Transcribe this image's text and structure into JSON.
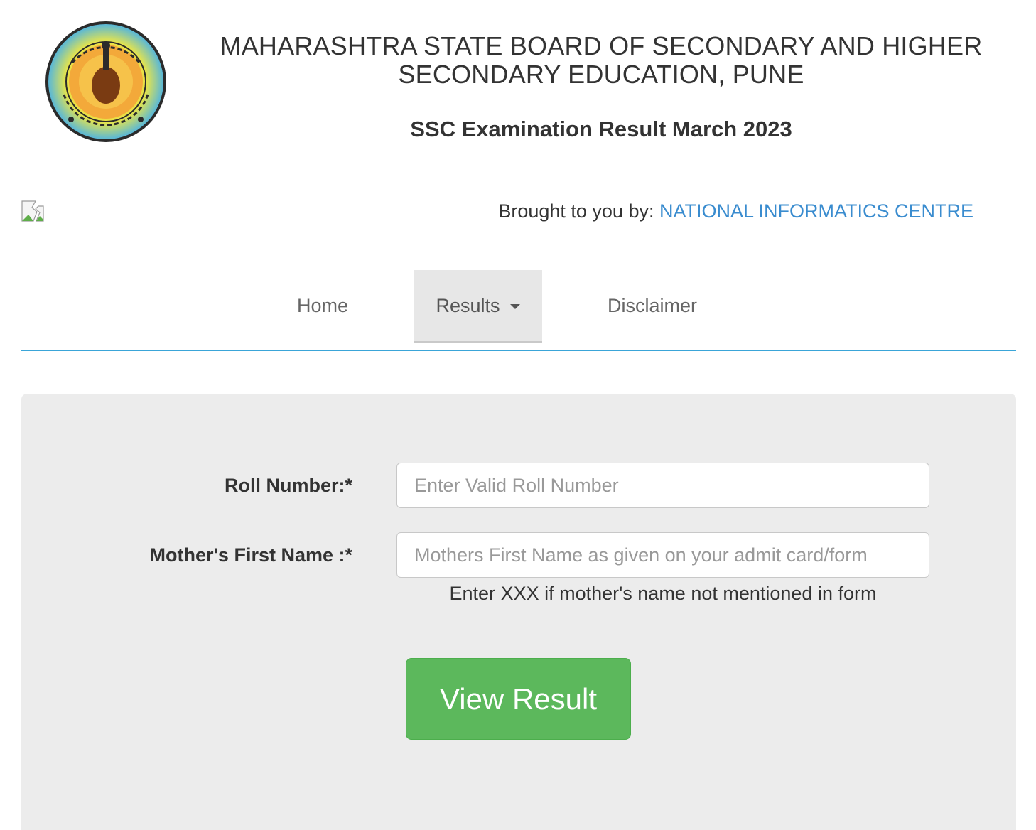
{
  "header": {
    "logo_icon": "msbshse-seal-icon",
    "title_line1": "MAHARASHTRA STATE BOARD OF SECONDARY AND HIGHER",
    "title_line2": "SECONDARY EDUCATION, PUNE",
    "subtitle": "SSC Examination Result March 2023"
  },
  "credit": {
    "prefix": "Brought to you by: ",
    "link_text": "NATIONAL INFORMATICS CENTRE",
    "link_color": "#3a8ccf"
  },
  "nav": {
    "items": [
      {
        "label": "Home"
      },
      {
        "label": "Results",
        "active": true,
        "dropdown": true
      },
      {
        "label": "Disclaimer"
      }
    ],
    "underline_color": "#3aa5d8"
  },
  "form": {
    "roll_label": "Roll Number:*",
    "roll_placeholder": "Enter Valid Roll Number",
    "roll_value": "",
    "mother_label": "Mother's First Name :*",
    "mother_placeholder": "Mothers First Name as given on your admit card/form",
    "mother_value": "",
    "hint": "Enter XXX if mother's name not mentioned in form",
    "submit_label": "View Result",
    "submit_color": "#5cb85c"
  }
}
